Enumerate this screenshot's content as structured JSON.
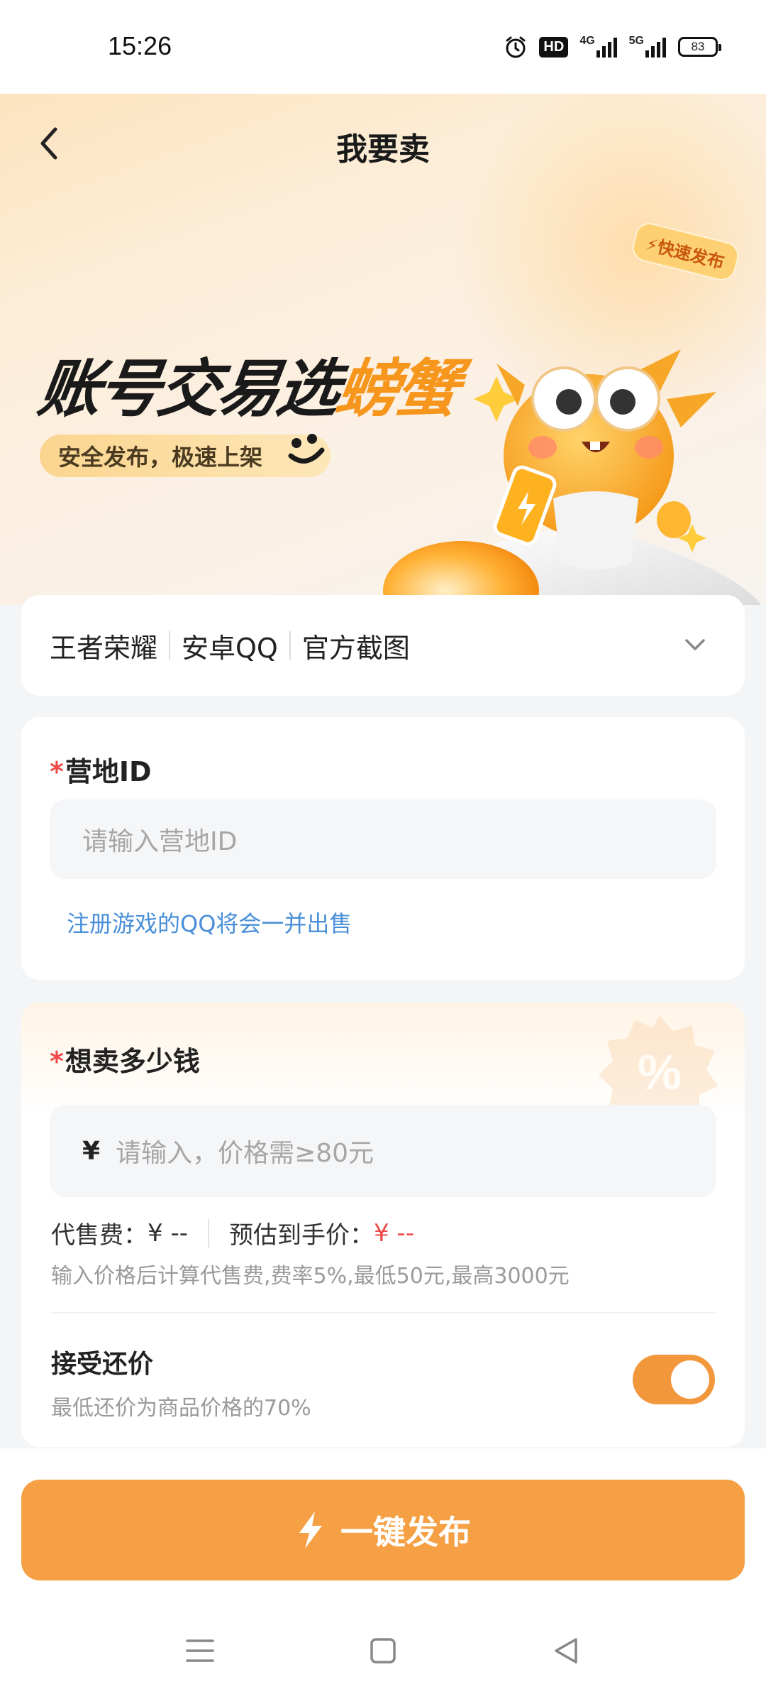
{
  "status_bar": {
    "time": "15:26",
    "hd_label": "HD",
    "net1": "4G",
    "net2": "5G",
    "battery": "83"
  },
  "header": {
    "title": "我要卖",
    "back_icon": "chevron-left-icon"
  },
  "banner": {
    "headline_main": "账号交易选",
    "headline_accent": "螃蟹",
    "tagline": "安全发布，极速上架",
    "badge": "⚡快速发布"
  },
  "selector": {
    "options": [
      "王者荣耀",
      "安卓QQ",
      "官方截图"
    ]
  },
  "camp_id": {
    "required_mark": "*",
    "label": "营地ID",
    "placeholder": "请输入营地ID",
    "hint": "注册游戏的QQ将会一并出售"
  },
  "price": {
    "required_mark": "*",
    "label": "想卖多少钱",
    "currency": "¥",
    "placeholder": "请输入，价格需≥80元",
    "fee_label": "代售费：",
    "fee_value": "¥ --",
    "receive_label": "预估到手价：",
    "receive_value": "¥ --",
    "fee_note": "输入价格后计算代售费,费率5%,最低50元,最高3000元",
    "accept_label": "接受还价",
    "accept_note": "最低还价为商品价格的70%",
    "accept_enabled": true
  },
  "footer": {
    "publish_label": "一键发布"
  },
  "colors": {
    "accent": "#f5a044",
    "link": "#4a8fd8",
    "required": "#ef4b4b"
  }
}
